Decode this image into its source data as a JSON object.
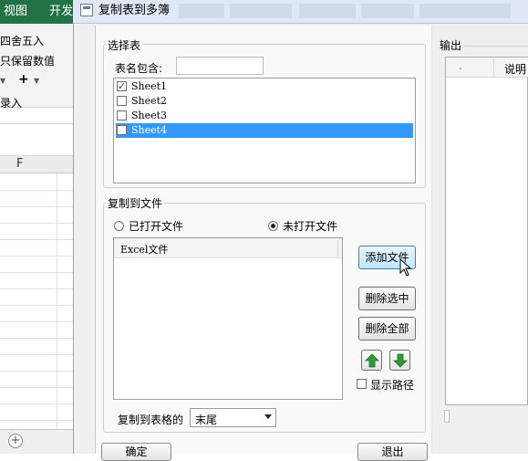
{
  "excel": {
    "tabs": [
      "视图",
      "开发"
    ],
    "ribbon": {
      "round_label": "四舍五入",
      "keep_value_label": "只保留数值",
      "plus_symbol": "+",
      "entry_label": "录入"
    },
    "column_letter": "F",
    "add_sheet_symbol": "+"
  },
  "dialog": {
    "title": "复制表到多簿",
    "select_sheets": {
      "group_label": "选择表",
      "filter_label": "表名包含:",
      "filter_value": "",
      "sheets": [
        {
          "name": "Sheet1",
          "checked": true,
          "selected": false
        },
        {
          "name": "Sheet2",
          "checked": false,
          "selected": false
        },
        {
          "name": "Sheet3",
          "checked": false,
          "selected": false
        },
        {
          "name": "Sheet4",
          "checked": false,
          "selected": true
        }
      ]
    },
    "copy_to_file": {
      "group_label": "复制到文件",
      "radio_opened": "已打开文件",
      "radio_unopened": "未打开文件",
      "selected_radio": "未打开文件",
      "file_list_header": "Excel文件",
      "add_file_button": "添加文件",
      "delete_selected_button": "删除选中",
      "delete_all_button": "删除全部",
      "move_up_icon": "green-up-arrow-icon",
      "move_down_icon": "green-down-arrow-icon",
      "show_path_label": "显示路径",
      "show_path_checked": false,
      "position_label": "复制到表格的",
      "position_value": "末尾"
    },
    "output": {
      "label": "输出",
      "columns": [
        ".",
        "说明"
      ]
    },
    "bottom_buttons": {
      "left": "确定",
      "right": "退出"
    }
  }
}
